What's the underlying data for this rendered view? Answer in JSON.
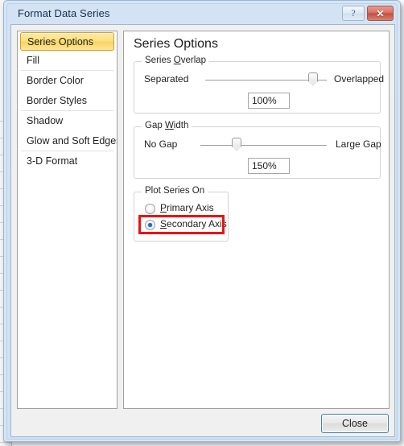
{
  "window": {
    "title": "Format Data Series",
    "help_button_glyph": "?",
    "close_button_glyph": "✕"
  },
  "sidebar": {
    "items": [
      {
        "label": "Series Options",
        "selected": true
      },
      {
        "label": "Fill",
        "selected": false
      },
      {
        "label": "Border Color",
        "selected": false
      },
      {
        "label": "Border Styles",
        "selected": false
      },
      {
        "label": "Shadow",
        "selected": false
      },
      {
        "label": "Glow and Soft Edges",
        "selected": false
      },
      {
        "label": "3-D Format",
        "selected": false
      }
    ]
  },
  "panel": {
    "heading": "Series Options",
    "series_overlap": {
      "label_pre": "Series ",
      "label_accel": "O",
      "label_post": "verlap",
      "left_label": "Separated",
      "right_label": "Overlapped",
      "value": "100%",
      "thumb_percent": 92
    },
    "gap_width": {
      "label_pre": "Gap ",
      "label_accel": "W",
      "label_post": "idth",
      "left_label": "No Gap",
      "right_label": "Large Gap",
      "value": "150%",
      "thumb_percent": 27
    },
    "plot_series_on": {
      "label": "Plot Series On",
      "options": [
        {
          "accel": "P",
          "rest": "rimary Axis",
          "checked": false
        },
        {
          "accel": "S",
          "rest": "econdary Axis",
          "checked": true
        }
      ]
    }
  },
  "footer": {
    "close_label": "Close"
  },
  "colors": {
    "accent_selected": "#f9d45f",
    "accent_selected_border": "#d79b1f",
    "annotation_red": "#ee1111",
    "titlebar_blue": "#d3e3f4",
    "close_red": "#c34f3d",
    "radio_dot_blue": "#1c6fc4"
  }
}
